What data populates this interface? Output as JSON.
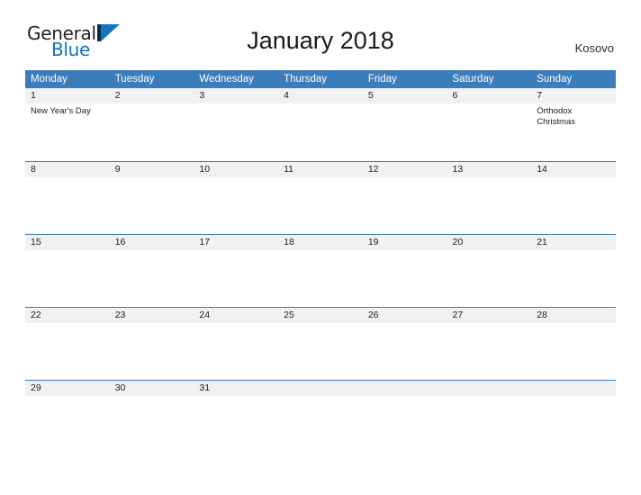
{
  "brand": {
    "word_one": "General",
    "word_two": "Blue",
    "mark_name": "blue-triangle-flag",
    "color_dark": "#231f20",
    "color_blue": "#1574bb"
  },
  "header": {
    "title": "January 2018",
    "country": "Kosovo"
  },
  "theme": {
    "header_blue": "#3b7cba",
    "daynum_band": "#f1f1f1",
    "grid_line": "#3b7cba",
    "text": "#1a1a1a",
    "page_background": "#ffffff"
  },
  "calendar": {
    "month": "January",
    "year": "2018",
    "weekday_headers": [
      "Monday",
      "Tuesday",
      "Wednesday",
      "Thursday",
      "Friday",
      "Saturday",
      "Sunday"
    ],
    "weeks": [
      {
        "days": [
          {
            "num": "1",
            "events": [
              "New Year's Day"
            ]
          },
          {
            "num": "2",
            "events": []
          },
          {
            "num": "3",
            "events": []
          },
          {
            "num": "4",
            "events": []
          },
          {
            "num": "5",
            "events": []
          },
          {
            "num": "6",
            "events": []
          },
          {
            "num": "7",
            "events": [
              "Orthodox Christmas"
            ]
          }
        ]
      },
      {
        "days": [
          {
            "num": "8",
            "events": []
          },
          {
            "num": "9",
            "events": []
          },
          {
            "num": "10",
            "events": []
          },
          {
            "num": "11",
            "events": []
          },
          {
            "num": "12",
            "events": []
          },
          {
            "num": "13",
            "events": []
          },
          {
            "num": "14",
            "events": []
          }
        ]
      },
      {
        "days": [
          {
            "num": "15",
            "events": []
          },
          {
            "num": "16",
            "events": []
          },
          {
            "num": "17",
            "events": []
          },
          {
            "num": "18",
            "events": []
          },
          {
            "num": "19",
            "events": []
          },
          {
            "num": "20",
            "events": []
          },
          {
            "num": "21",
            "events": []
          }
        ]
      },
      {
        "days": [
          {
            "num": "22",
            "events": []
          },
          {
            "num": "23",
            "events": []
          },
          {
            "num": "24",
            "events": []
          },
          {
            "num": "25",
            "events": []
          },
          {
            "num": "26",
            "events": []
          },
          {
            "num": "27",
            "events": []
          },
          {
            "num": "28",
            "events": []
          }
        ]
      },
      {
        "days": [
          {
            "num": "29",
            "events": []
          },
          {
            "num": "30",
            "events": []
          },
          {
            "num": "31",
            "events": []
          },
          {
            "num": "",
            "events": []
          },
          {
            "num": "",
            "events": []
          },
          {
            "num": "",
            "events": []
          },
          {
            "num": "",
            "events": []
          }
        ]
      }
    ]
  }
}
